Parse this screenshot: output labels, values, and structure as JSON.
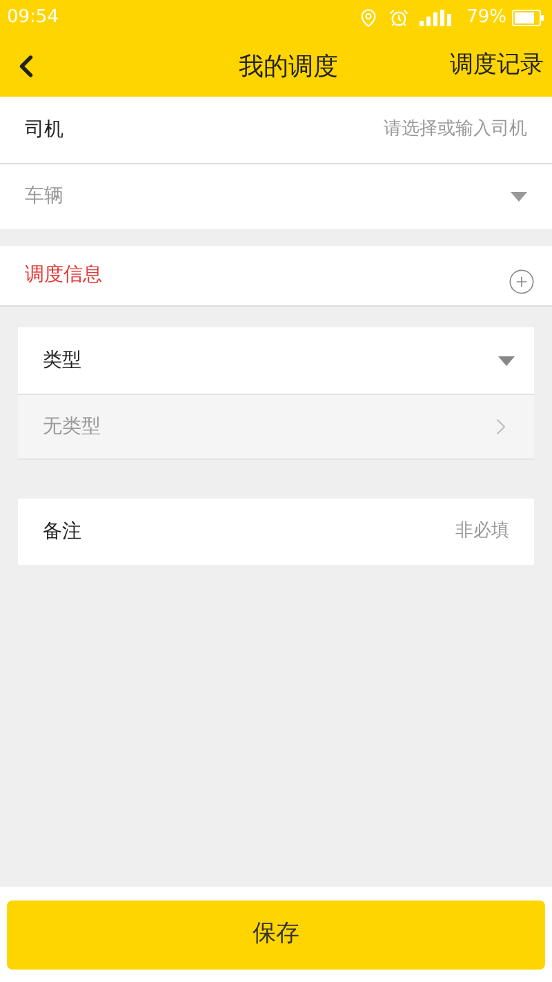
{
  "status_bar": {
    "time": "09:54",
    "battery": "79%"
  },
  "header": {
    "title": "我的调度",
    "action": "调度记录"
  },
  "vehicle_fields": [
    {
      "kind": "input",
      "label": "司机",
      "placeholder": "请选择或输入司机",
      "disabled": false
    },
    {
      "kind": "select",
      "label": "车辆",
      "disabled": true
    }
  ],
  "dispatch_section": {
    "title": "调度信息"
  },
  "type_card": {
    "label": "类型",
    "expanded": true,
    "options": [
      {
        "label": "无类型"
      }
    ]
  },
  "remark": {
    "label": "备注",
    "placeholder": "非必填"
  },
  "save_button": "保存"
}
